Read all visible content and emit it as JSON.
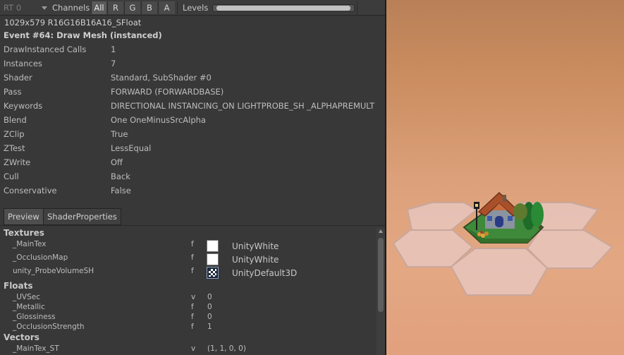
{
  "toolbar": {
    "rt_label": "RT 0",
    "channels_label": "Channels",
    "channel_buttons": [
      "All",
      "R",
      "G",
      "B",
      "A"
    ],
    "levels_label": "Levels"
  },
  "texture_format": "1029x579 R16G16B16A16_SFloat",
  "event_title": "Event #64: Draw Mesh (instanced)",
  "details": [
    {
      "key": "DrawInstanced Calls",
      "value": "1"
    },
    {
      "key": "Instances",
      "value": "7"
    },
    {
      "key": "Shader",
      "value": "Standard, SubShader #0"
    },
    {
      "key": "Pass",
      "value": "FORWARD (FORWARDBASE)"
    },
    {
      "key": "Keywords",
      "value": "DIRECTIONAL INSTANCING_ON LIGHTPROBE_SH _ALPHAPREMULT"
    },
    {
      "key": "Blend",
      "value": "One OneMinusSrcAlpha"
    },
    {
      "key": "ZClip",
      "value": "True"
    },
    {
      "key": "ZTest",
      "value": "LessEqual"
    },
    {
      "key": "ZWrite",
      "value": "Off"
    },
    {
      "key": "Cull",
      "value": "Back"
    },
    {
      "key": "Conservative",
      "value": "False"
    }
  ],
  "tabs": [
    "Preview",
    "ShaderProperties"
  ],
  "sections": {
    "textures": "Textures",
    "floats": "Floats",
    "vectors": "Vectors"
  },
  "textures": [
    {
      "name": "_MainTex",
      "type": "f",
      "value": "UnityWhite"
    },
    {
      "name": "_OcclusionMap",
      "type": "f",
      "value": "UnityWhite"
    },
    {
      "name": "unity_ProbeVolumeSH",
      "type": "f",
      "value": "UnityDefault3D"
    }
  ],
  "floats": [
    {
      "name": "_UVSec",
      "type": "v",
      "value": "0"
    },
    {
      "name": "_Metallic",
      "type": "f",
      "value": "0"
    },
    {
      "name": "_Glossiness",
      "type": "f",
      "value": "0"
    },
    {
      "name": "_OcclusionStrength",
      "type": "f",
      "value": "1"
    }
  ],
  "vectors": [
    {
      "name": "_MainTex_ST",
      "type": "v",
      "value": "(1, 1, 0, 0)"
    }
  ]
}
